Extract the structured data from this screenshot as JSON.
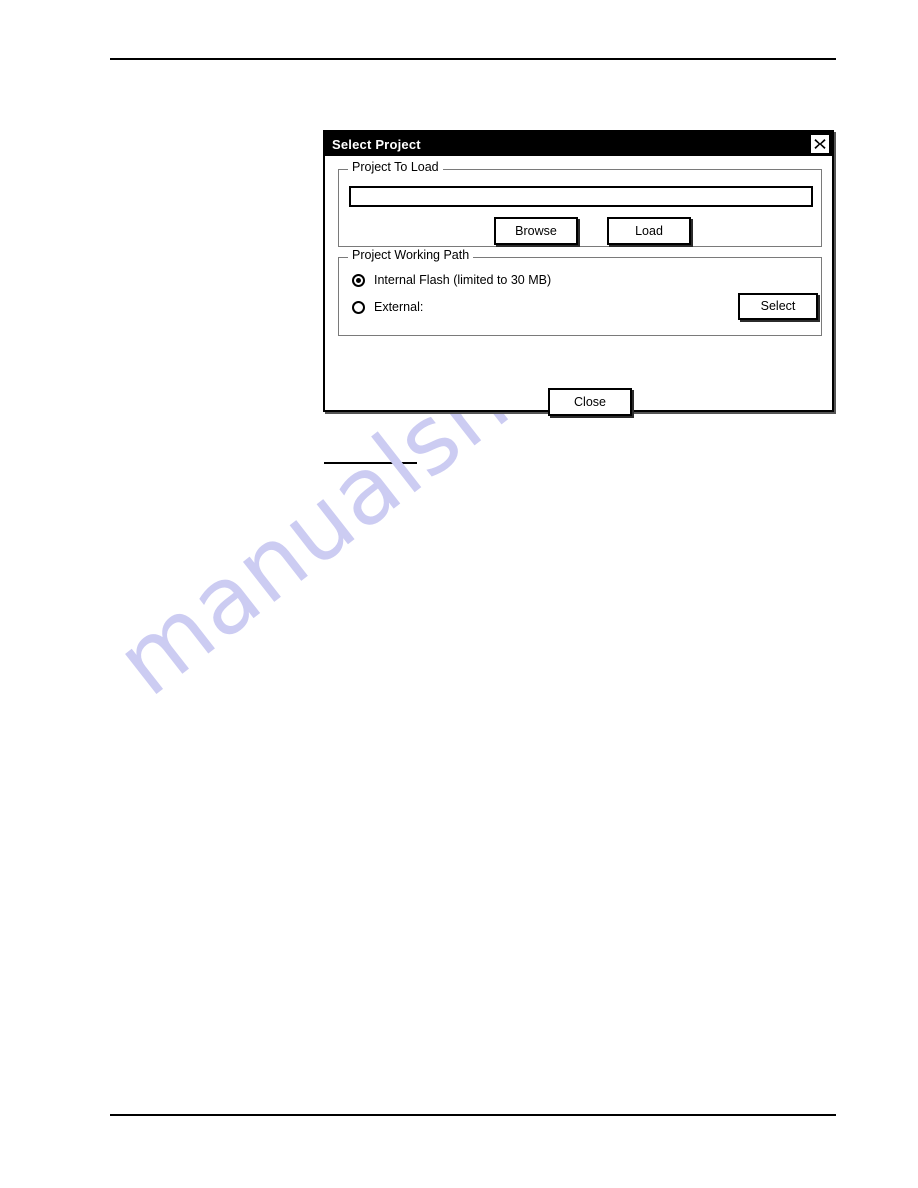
{
  "page": {
    "header_rule": "",
    "footer_rule": "",
    "body_rule": "",
    "watermark": "manualshive.com",
    "watermark_color": "#ccccf2"
  },
  "dialog": {
    "title": "Select Project",
    "close_icon": "close-x-icon",
    "title_bar_color": "#000000",
    "title_text_color": "#ffffff",
    "groups": {
      "project_to_load": {
        "legend": "Project To Load",
        "path_input": {
          "value": "",
          "placeholder": ""
        },
        "buttons": {
          "browse": "Browse",
          "load": "Load"
        }
      },
      "project_working_path": {
        "legend": "Project Working Path",
        "options": [
          {
            "label": "Internal Flash (limited to 30 MB)",
            "selected": true
          },
          {
            "label": "External:",
            "selected": false
          }
        ],
        "buttons": {
          "select": "Select"
        }
      }
    },
    "buttons": {
      "close": "Close"
    }
  }
}
